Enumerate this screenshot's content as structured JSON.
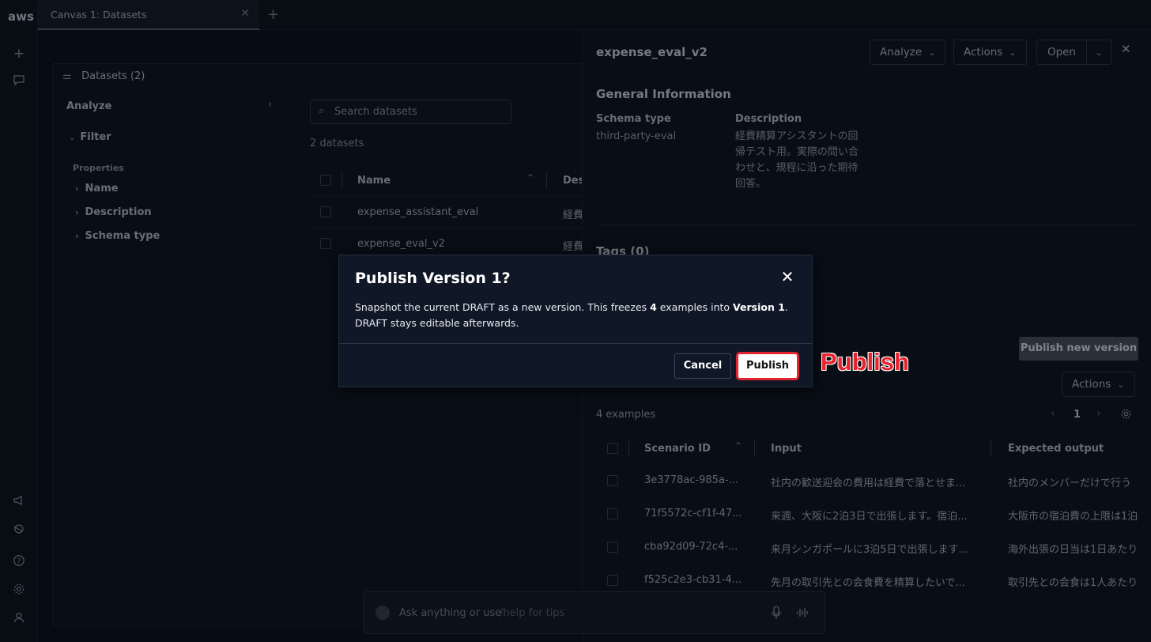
{
  "rail": {
    "logo": "aws"
  },
  "tabs": {
    "active_label": "Canvas 1: Datasets",
    "close_glyph": "✕",
    "add_glyph": "+"
  },
  "left": {
    "header_title": "Datasets (2)",
    "analyze_label": "Analyze",
    "filter_label": "Filter",
    "properties_label": "Properties",
    "properties": [
      "Name",
      "Description",
      "Schema type"
    ],
    "search_placeholder": "Search datasets",
    "count_label": "2 datasets",
    "col_name": "Name",
    "col_desc": "Desc",
    "rows": [
      {
        "name": "expense_assistant_eval",
        "desc": "経費"
      },
      {
        "name": "expense_eval_v2",
        "desc": "経費"
      }
    ]
  },
  "right": {
    "title": "expense_eval_v2",
    "analyze_btn": "Analyze",
    "actions_btn": "Actions",
    "open_btn": "Open",
    "general_info": "General Information",
    "schema_type_label": "Schema type",
    "schema_type_value": "third-party-eval",
    "description_label": "Description",
    "description_value": "経費精算アシスタントの回帰テスト用。実際の問い合わせと、規程に沿った期待回答。",
    "tags_label": "Tags (0)",
    "publish_new_version": "Publish new version",
    "actions_btn2": "Actions",
    "examples_count": "4 examples",
    "page_number": "1",
    "col_scenario": "Scenario ID",
    "col_input": "Input",
    "col_expected": "Expected output",
    "rows": [
      {
        "id": "3e3778ac-985a-...",
        "input": "社内の歓送迎会の費用は経費で落とせま...",
        "expected": "社内のメンバーだけで行う"
      },
      {
        "id": "71f5572c-cf1f-47...",
        "input": "来週、大阪に2泊3日で出張します。宿泊...",
        "expected": "大阪市の宿泊費の上限は1泊"
      },
      {
        "id": "cba92d09-72c4-...",
        "input": "来月シンガポールに3泊5日で出張します...",
        "expected": "海外出張の日当は1日あたり"
      },
      {
        "id": "f525c2e3-cb31-4...",
        "input": "先月の取引先との会食費を精算したいで...",
        "expected": "取引先との会食は1人あたり"
      }
    ]
  },
  "chat": {
    "placeholder_main": "Ask anything or use",
    "placeholder_hint": "/help for tips"
  },
  "modal": {
    "title": "Publish Version 1?",
    "body_part1": "Snapshot the current DRAFT as a new version. This freezes ",
    "body_count": "4",
    "body_part2": " examples into ",
    "body_version": "Version 1",
    "body_part3": ". DRAFT stays editable afterwards.",
    "cancel_label": "Cancel",
    "publish_label": "Publish"
  },
  "annotation": {
    "text": "Publish",
    "color": "#e8232e"
  }
}
